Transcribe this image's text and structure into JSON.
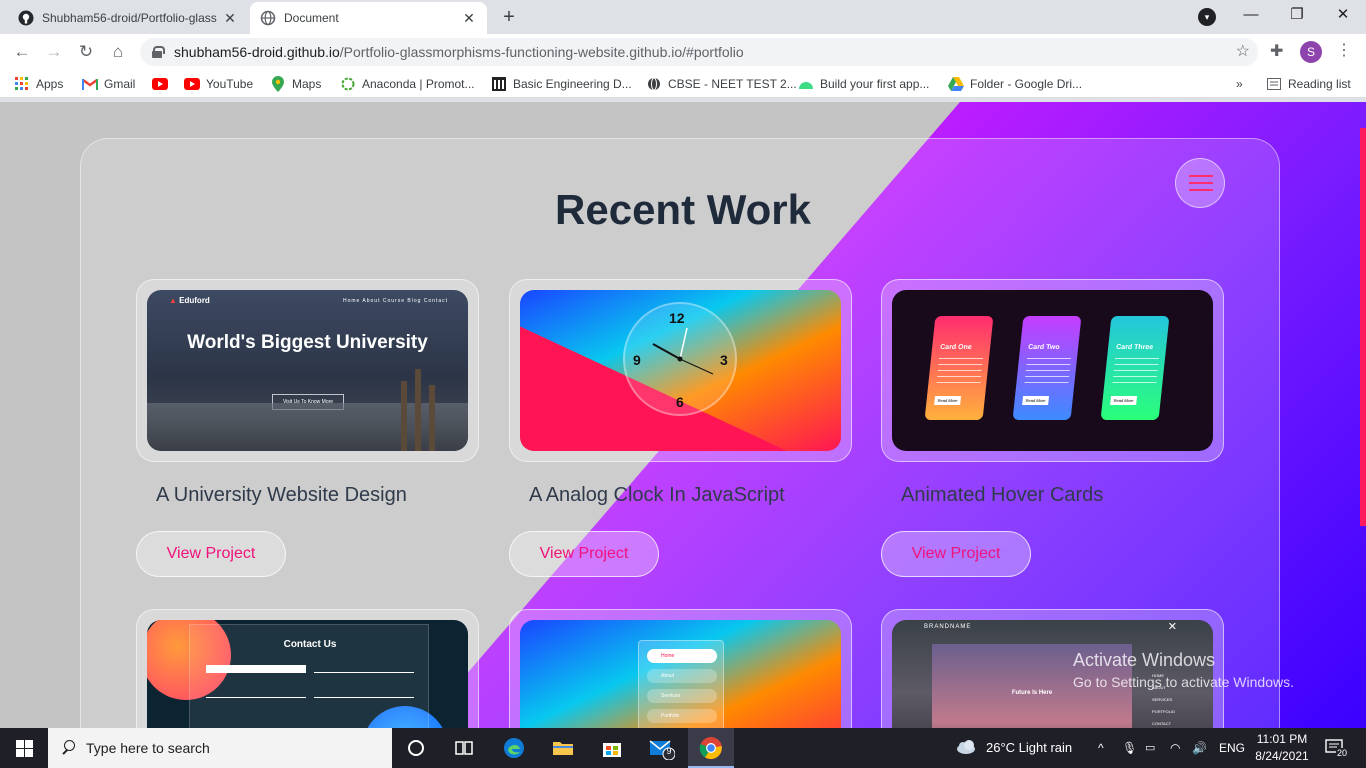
{
  "browser": {
    "tabs": [
      {
        "title": "Shubham56-droid/Portfolio-glass",
        "icon": "github-icon",
        "active": false
      },
      {
        "title": "Document",
        "icon": "globe-icon",
        "active": true
      }
    ],
    "url_host": "shubham56-droid.github.io",
    "url_path": "/Portfolio-glassmorphisms-functioning-website.github.io/#portfolio",
    "profile_initial": "S",
    "bookmarks": [
      {
        "label": "Apps",
        "icon": "apps-grid-icon"
      },
      {
        "label": "Gmail",
        "icon": "gmail-icon"
      },
      {
        "label": "",
        "icon": "youtube-icon"
      },
      {
        "label": "YouTube",
        "icon": "youtube-icon"
      },
      {
        "label": "Maps",
        "icon": "maps-pin-icon"
      },
      {
        "label": "Anaconda | Promot...",
        "icon": "anaconda-icon"
      },
      {
        "label": "Basic Engineering D...",
        "icon": "building-icon"
      },
      {
        "label": "CBSE - NEET TEST 2...",
        "icon": "globe-icon"
      },
      {
        "label": "Build your first app...",
        "icon": "android-icon"
      },
      {
        "label": "Folder - Google Dri...",
        "icon": "drive-icon"
      }
    ],
    "more_bookmarks": "»",
    "reading_list": "Reading list"
  },
  "page": {
    "section_title": "Recent Work",
    "projects": [
      {
        "title": "A University Website Design",
        "button": "View Project",
        "thumb": {
          "brand": "Eduford",
          "nav": "Home  About  Course  Blog  Contact",
          "headline": "World's Biggest University",
          "cta": "Visit Us To Know More"
        }
      },
      {
        "title": "A Analog Clock In JavaScript",
        "button": "View Project",
        "thumb": {
          "n12": "12",
          "n3": "3",
          "n6": "6",
          "n9": "9"
        }
      },
      {
        "title": "Animated Hover Cards",
        "button": "View Project",
        "thumb": {
          "c1": "Card One",
          "c2": "Card Two",
          "c3": "Card Three",
          "btn": "Read More"
        }
      },
      {
        "thumb": {
          "heading": "Contact Us"
        }
      },
      {
        "thumb": {
          "items": [
            "Home",
            "About",
            "Services",
            "Portfolio"
          ]
        }
      },
      {
        "thumb": {
          "brand": "BRANDNAME",
          "close": "✕",
          "hero": "Future Is Here",
          "menu": [
            "HOME",
            "ABOUT",
            "SERVICES",
            "PORTFOLIO",
            "CONTACT"
          ]
        }
      }
    ],
    "watermark_line1": "Activate Windows",
    "watermark_line2": "Go to Settings to activate Windows."
  },
  "taskbar": {
    "search_placeholder": "Type here to search",
    "mail_badge": "9",
    "weather": "26°C  Light rain",
    "language": "ENG",
    "time": "11:01 PM",
    "date": "8/24/2021",
    "notifications": "20"
  }
}
